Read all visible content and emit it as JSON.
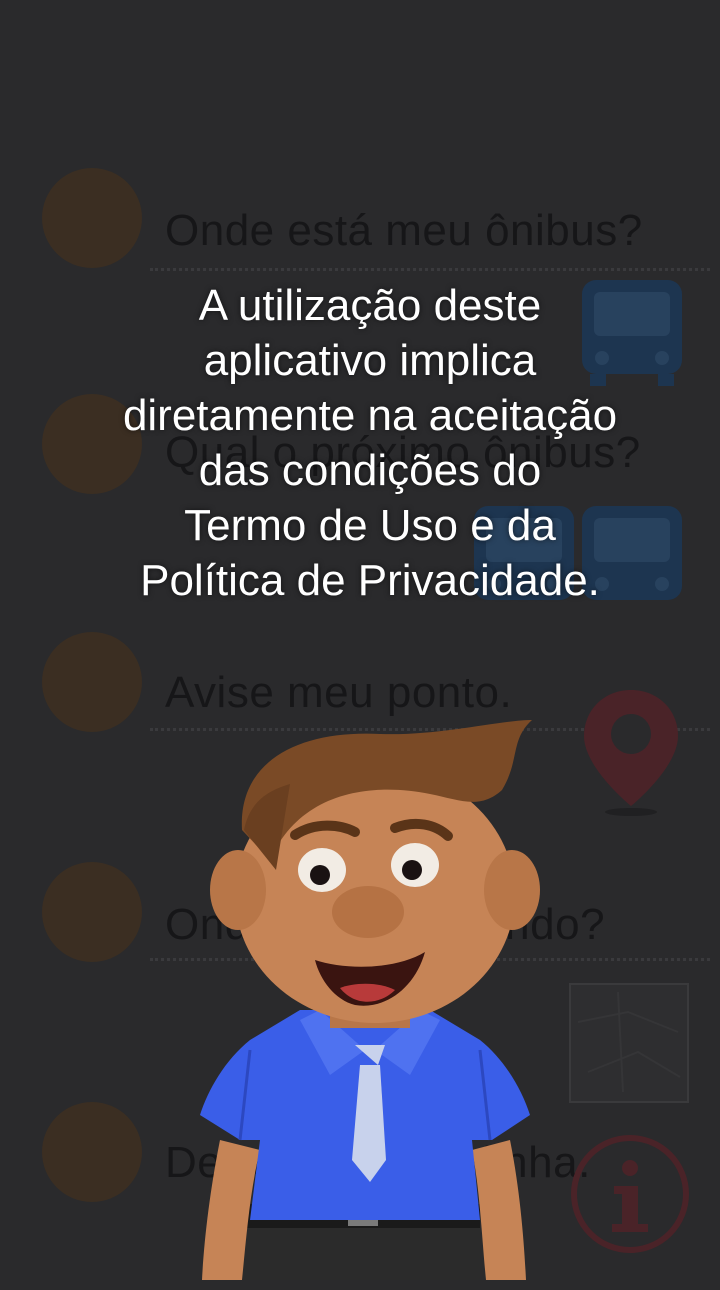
{
  "menu": {
    "items": [
      {
        "label": "Onde está meu ônibus?"
      },
      {
        "label": "Qual o próximo ônibus?"
      },
      {
        "label": "Avise meu ponto."
      },
      {
        "label": "Onde está passando?"
      },
      {
        "label": "De onde vem a linha."
      }
    ]
  },
  "notice": {
    "lines": [
      "A utilização deste",
      "aplicativo implica",
      "diretamente na aceitação",
      "das condições do",
      "Termo de Uso e da",
      "Política de Privacidade."
    ]
  },
  "colors": {
    "background": "#2a2a2c",
    "bullet": "#3b2e22",
    "bus_icon": "#1d3550",
    "pin_icon": "#4a2328",
    "shirt": "#3a5ee8",
    "skin": "#c68456",
    "hair": "#7a4a26"
  },
  "icons": [
    "bus-icon",
    "buses-icon",
    "map-pin-icon",
    "map-icon",
    "info-icon"
  ]
}
